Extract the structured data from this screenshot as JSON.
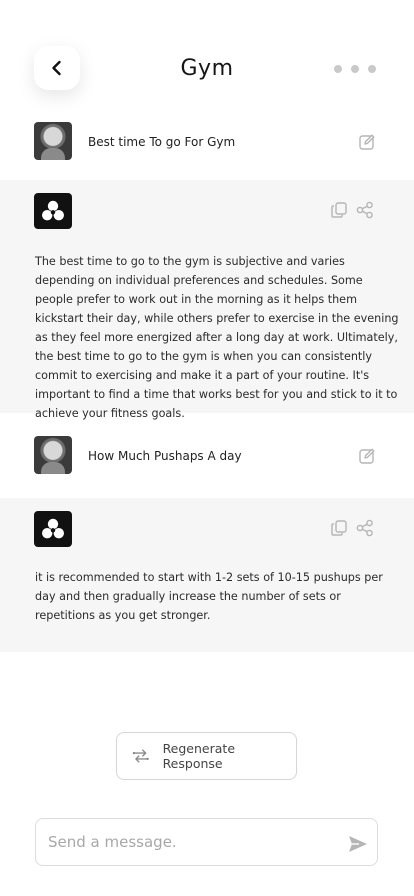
{
  "header": {
    "title": "Gym",
    "back_icon": "chevron-left-icon",
    "more_icon": "more-dots-icon"
  },
  "conversation": [
    {
      "role": "user",
      "text": "Best time To go For Gym",
      "avatar": "astronaut-avatar",
      "action_icon": "edit-icon"
    },
    {
      "role": "assistant",
      "avatar": "bot-logo",
      "action_icons": [
        "copy-icon",
        "share-icon"
      ],
      "text": "The best time to go to the gym is subjective and varies depending on individual preferences and schedules. Some people prefer to work out in the morning as it helps them kickstart their day, while others prefer to exercise in the evening as they feel more energized after a long day at work. Ultimately, the best time to go to the gym is when you can consistently commit to exercising and make it a part of your routine. It's important to find a time that works best for you and stick to it to achieve your fitness goals."
    },
    {
      "role": "user",
      "text": "How Much Pushaps A day",
      "avatar": "astronaut-avatar",
      "action_icon": "edit-icon"
    },
    {
      "role": "assistant",
      "avatar": "bot-logo",
      "action_icons": [
        "copy-icon",
        "share-icon"
      ],
      "text": "it is recommended to start with 1-2 sets of 10-15 pushups per day and then gradually increase the number of sets or repetitions as you get stronger."
    }
  ],
  "regenerate": {
    "label": "Regenerate Response",
    "icon": "regenerate-icon"
  },
  "composer": {
    "placeholder": "Send a message.",
    "value": "",
    "send_icon": "send-icon"
  },
  "colors": {
    "background": "#ffffff",
    "assistant_bg": "#f6f6f6",
    "icon_grey": "#b5b5b5",
    "text": "#2b2b2b"
  }
}
